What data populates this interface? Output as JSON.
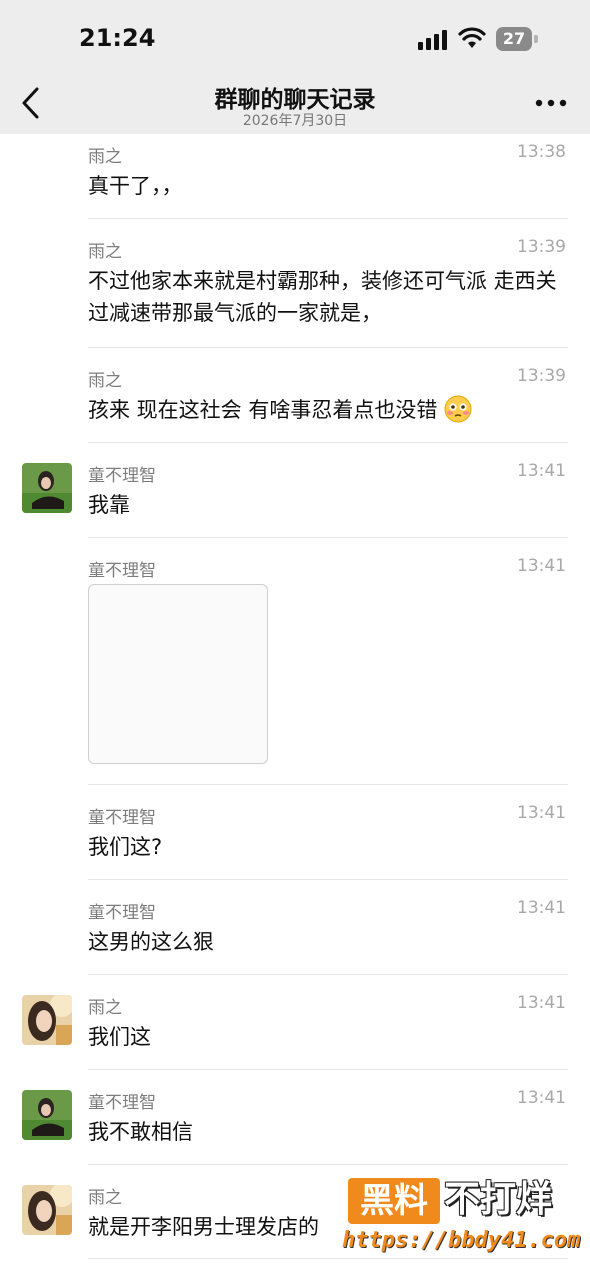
{
  "status_bar": {
    "time": "21:24",
    "battery": "27"
  },
  "nav": {
    "title": "群聊的聊天记录",
    "subtitle": "2026年7月30日"
  },
  "messages": [
    {
      "sender": "雨之",
      "time": "13:38",
      "text": "真干了，，",
      "avatar": "none"
    },
    {
      "sender": "雨之",
      "time": "13:39",
      "text": "不过他家本来就是村霸那种，装修还可气派 走西关过减速带那最气派的一家就是，",
      "avatar": "none"
    },
    {
      "sender": "雨之",
      "time": "13:39",
      "text": "孩来 现在这社会 有啥事忍着点也没错",
      "avatar": "none",
      "emoji": "flushed-face"
    },
    {
      "sender": "童不理智",
      "time": "13:41",
      "text": "我靠",
      "avatar": "green"
    },
    {
      "sender": "童不理智",
      "time": "13:41",
      "text": "",
      "avatar": "none",
      "image": true
    },
    {
      "sender": "童不理智",
      "time": "13:41",
      "text": "我们这?",
      "avatar": "none"
    },
    {
      "sender": "童不理智",
      "time": "13:41",
      "text": "这男的这么狠",
      "avatar": "none"
    },
    {
      "sender": "雨之",
      "time": "13:41",
      "text": "我们这",
      "avatar": "warm"
    },
    {
      "sender": "童不理智",
      "time": "13:41",
      "text": "我不敢相信",
      "avatar": "green"
    },
    {
      "sender": "雨之",
      "time": "",
      "text": "就是开李阳男士理发店的",
      "avatar": "warm"
    }
  ],
  "watermark": {
    "box": "黑料",
    "right": "不打烊",
    "url": "https://bbdy41.com"
  },
  "colors": {
    "header_bg": "#ededed",
    "watermark_orange": "#f08a1c"
  }
}
